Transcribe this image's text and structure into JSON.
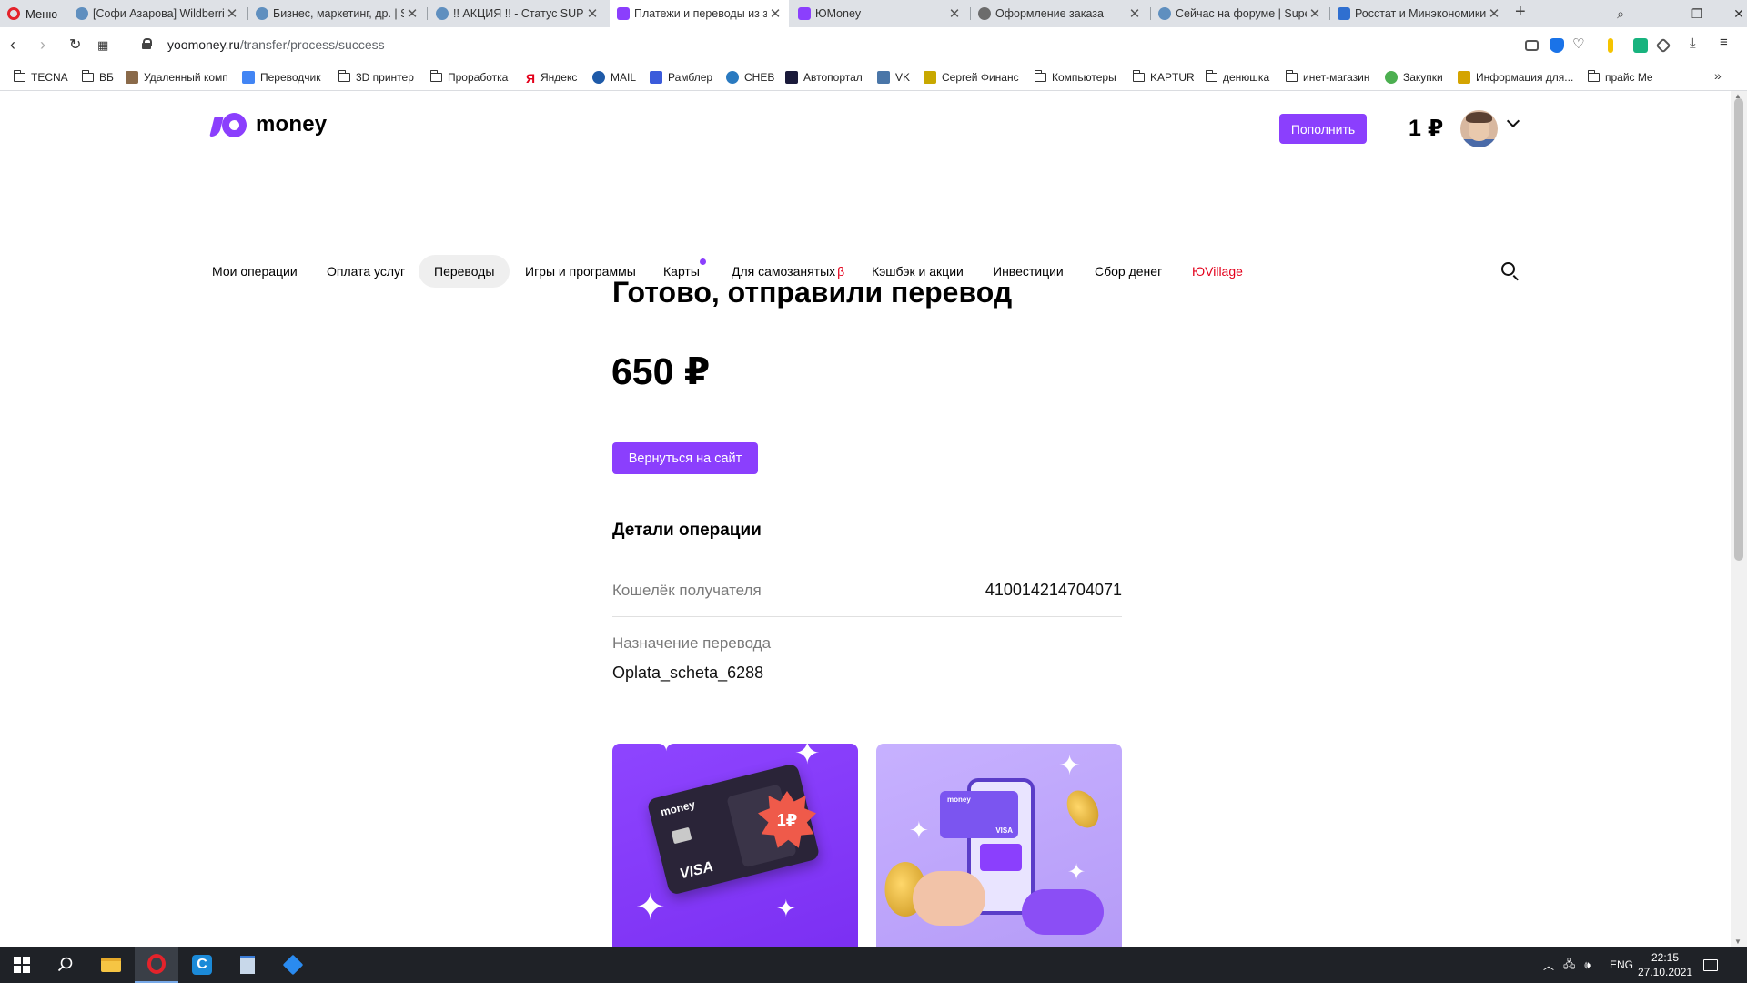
{
  "browser": {
    "menu_label": "Меню",
    "tabs": [
      {
        "title": "[Софи Азарова] Wildberries",
        "icon": "globe-icon",
        "active": false
      },
      {
        "title": "Бизнес, маркетинг, др. | Su",
        "icon": "globe-icon",
        "active": false
      },
      {
        "title": "!! АКЦИЯ !! - Статус SUPER",
        "icon": "globe-icon",
        "active": false
      },
      {
        "title": "Платежи и переводы из з",
        "icon": "yoomoney-icon",
        "active": true
      },
      {
        "title": "ЮMoney",
        "icon": "yoomoney-icon",
        "active": false
      },
      {
        "title": "Оформление заказа",
        "icon": "globe-icon",
        "active": false
      },
      {
        "title": "Сейчас на форуме | Super",
        "icon": "globe-icon",
        "active": false
      },
      {
        "title": "Росстат и Минэкономики",
        "icon": "mail-icon",
        "active": false
      }
    ],
    "url_host": "yoomoney.ru",
    "url_path": "/transfer/process/success",
    "bookmarks": [
      {
        "label": "TECNA",
        "icon": "folder-icon"
      },
      {
        "label": "ВБ",
        "icon": "folder-icon"
      },
      {
        "label": "Удаленный комп",
        "icon": "remote-desktop-icon"
      },
      {
        "label": "Переводчик",
        "icon": "translate-icon"
      },
      {
        "label": "3D принтер",
        "icon": "folder-icon"
      },
      {
        "label": "Проработка",
        "icon": "folder-icon"
      },
      {
        "label": "Яндекс",
        "icon": "yandex-icon"
      },
      {
        "label": "MAIL",
        "icon": "mail-icon"
      },
      {
        "label": "Рамблер",
        "icon": "rambler-icon"
      },
      {
        "label": "CHEB",
        "icon": "cheb-icon"
      },
      {
        "label": "Автопортал",
        "icon": "zr-icon"
      },
      {
        "label": "VK",
        "icon": "vk-icon"
      },
      {
        "label": "Сергей Финанс",
        "icon": "finance-icon"
      },
      {
        "label": "Компьютеры",
        "icon": "folder-icon"
      },
      {
        "label": "KAPTUR",
        "icon": "folder-icon"
      },
      {
        "label": "денюшка",
        "icon": "folder-icon"
      },
      {
        "label": "инет-магазин",
        "icon": "folder-icon"
      },
      {
        "label": "Закупки",
        "icon": "zakupki-icon"
      },
      {
        "label": "Информация для...",
        "icon": "info-icon"
      },
      {
        "label": "прайс Me",
        "icon": "folder-icon"
      }
    ]
  },
  "site": {
    "logo_text": "money",
    "topup_label": "Пополнить",
    "balance": "1 ₽",
    "nav": [
      {
        "label": "Мои операции"
      },
      {
        "label": "Оплата услуг"
      },
      {
        "label": "Переводы",
        "active": true
      },
      {
        "label": "Игры и программы"
      },
      {
        "label": "Карты",
        "dot": true
      },
      {
        "label": "Для самозанятых",
        "suffix": "β"
      },
      {
        "label": "Кэшбэк и акции"
      },
      {
        "label": "Инвестиции"
      },
      {
        "label": "Сбор денег"
      },
      {
        "label": "ЮVillage",
        "color": "#e3001b"
      }
    ]
  },
  "success": {
    "title": "Готово, отправили перевод",
    "amount": "650 ₽",
    "back_button": "Вернуться на сайт",
    "details_title": "Детали операции",
    "details": [
      {
        "label": "Кошелёк получателя",
        "value": "410014214704071"
      },
      {
        "label": "Назначение перевода",
        "value": "Oplata_scheta_6288"
      }
    ]
  },
  "promos": [
    {
      "card_brand": "money",
      "card_network": "VISA",
      "badge": "1₽"
    },
    {
      "card_brand": "money",
      "card_network": "VISA"
    }
  ],
  "taskbar": {
    "lang": "ENG",
    "time": "22:15",
    "date": "27.10.2021"
  },
  "colors": {
    "accent": "#8b3ffd",
    "red": "#e3001b"
  }
}
